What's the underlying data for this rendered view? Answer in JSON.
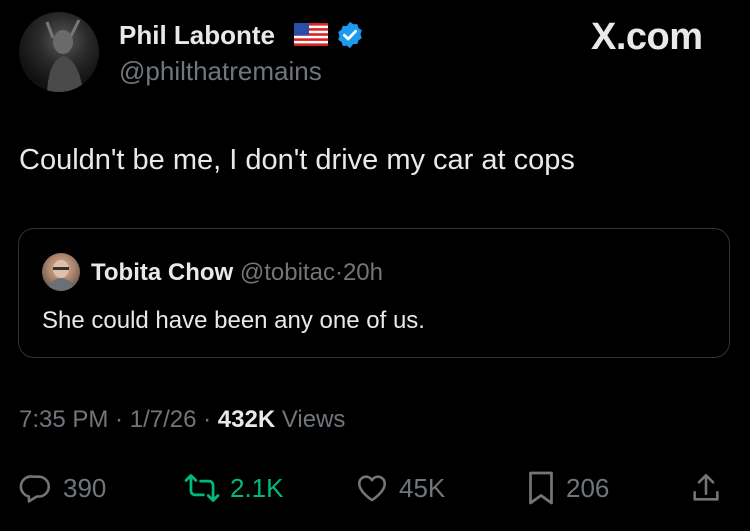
{
  "author": {
    "name": "Phil Labonte",
    "handle": "@philthatremains"
  },
  "brand": "X.com",
  "tweet": {
    "text": "Couldn't be me, I don't drive my car at cops"
  },
  "quote": {
    "name": "Tobita Chow",
    "handle": "@tobitac",
    "separator": "·",
    "time": "20h",
    "text": "She could have been any one of us."
  },
  "meta": {
    "time": "7:35 PM",
    "sep1": " · ",
    "date": "1/7/26",
    "sep2": " · ",
    "views_count": "432K",
    "views_label": " Views"
  },
  "actions": {
    "replies": "390",
    "reposts": "2.1K",
    "likes": "45K",
    "bookmarks": "206"
  },
  "colors": {
    "background": "#000000",
    "text": "#e7e9ea",
    "secondary": "#71767b",
    "verified": "#1d9bf0",
    "repost_active": "#00ba7c",
    "border": "#2f3336"
  },
  "icons": [
    "flag-us-icon",
    "verified-badge-icon",
    "reply-icon",
    "repost-icon",
    "like-icon",
    "bookmark-icon",
    "share-icon"
  ]
}
